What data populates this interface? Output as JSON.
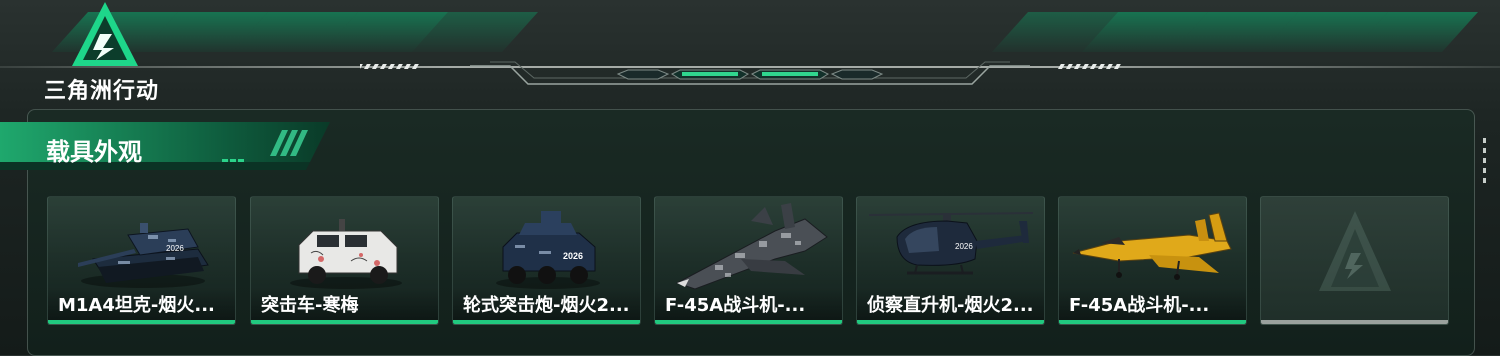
{
  "brand": {
    "name": "三角洲行动",
    "accent": "#21c97f"
  },
  "section": {
    "title": "载具外观"
  },
  "vehicles": [
    {
      "name": "M1A4坦克-烟火...",
      "icon": "tank-icon"
    },
    {
      "name": "突击车-寒梅",
      "icon": "assault-vehicle-icon"
    },
    {
      "name": "轮式突击炮-烟火2...",
      "icon": "wheeled-assault-gun-icon"
    },
    {
      "name": "F-45A战斗机-...",
      "icon": "fighter-jet-icon"
    },
    {
      "name": "侦察直升机-烟火2...",
      "icon": "helicopter-icon"
    },
    {
      "name": "F-45A战斗机-...",
      "icon": "fighter-jet-yellow-icon"
    },
    {
      "name": "",
      "icon": "placeholder-logo-icon"
    }
  ]
}
